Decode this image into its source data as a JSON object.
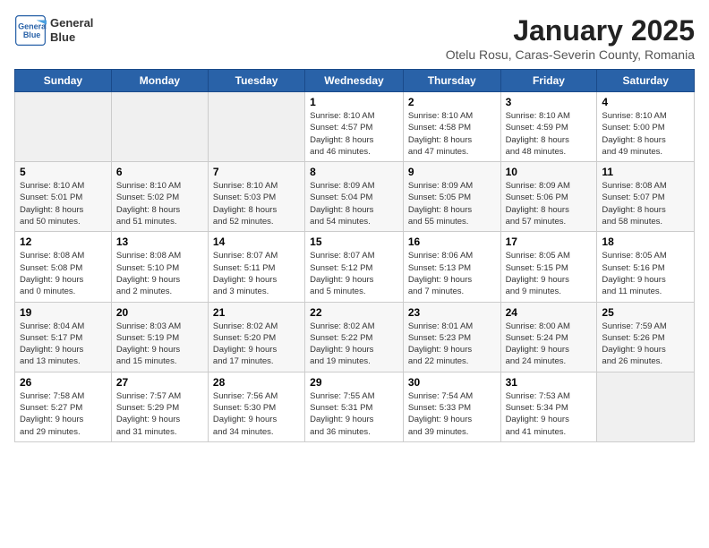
{
  "header": {
    "title": "January 2025",
    "subtitle": "Otelu Rosu, Caras-Severin County, Romania",
    "logo_line1": "General",
    "logo_line2": "Blue"
  },
  "days_of_week": [
    "Sunday",
    "Monday",
    "Tuesday",
    "Wednesday",
    "Thursday",
    "Friday",
    "Saturday"
  ],
  "weeks": [
    [
      {
        "day": "",
        "info": ""
      },
      {
        "day": "",
        "info": ""
      },
      {
        "day": "",
        "info": ""
      },
      {
        "day": "1",
        "info": "Sunrise: 8:10 AM\nSunset: 4:57 PM\nDaylight: 8 hours\nand 46 minutes."
      },
      {
        "day": "2",
        "info": "Sunrise: 8:10 AM\nSunset: 4:58 PM\nDaylight: 8 hours\nand 47 minutes."
      },
      {
        "day": "3",
        "info": "Sunrise: 8:10 AM\nSunset: 4:59 PM\nDaylight: 8 hours\nand 48 minutes."
      },
      {
        "day": "4",
        "info": "Sunrise: 8:10 AM\nSunset: 5:00 PM\nDaylight: 8 hours\nand 49 minutes."
      }
    ],
    [
      {
        "day": "5",
        "info": "Sunrise: 8:10 AM\nSunset: 5:01 PM\nDaylight: 8 hours\nand 50 minutes."
      },
      {
        "day": "6",
        "info": "Sunrise: 8:10 AM\nSunset: 5:02 PM\nDaylight: 8 hours\nand 51 minutes."
      },
      {
        "day": "7",
        "info": "Sunrise: 8:10 AM\nSunset: 5:03 PM\nDaylight: 8 hours\nand 52 minutes."
      },
      {
        "day": "8",
        "info": "Sunrise: 8:09 AM\nSunset: 5:04 PM\nDaylight: 8 hours\nand 54 minutes."
      },
      {
        "day": "9",
        "info": "Sunrise: 8:09 AM\nSunset: 5:05 PM\nDaylight: 8 hours\nand 55 minutes."
      },
      {
        "day": "10",
        "info": "Sunrise: 8:09 AM\nSunset: 5:06 PM\nDaylight: 8 hours\nand 57 minutes."
      },
      {
        "day": "11",
        "info": "Sunrise: 8:08 AM\nSunset: 5:07 PM\nDaylight: 8 hours\nand 58 minutes."
      }
    ],
    [
      {
        "day": "12",
        "info": "Sunrise: 8:08 AM\nSunset: 5:08 PM\nDaylight: 9 hours\nand 0 minutes."
      },
      {
        "day": "13",
        "info": "Sunrise: 8:08 AM\nSunset: 5:10 PM\nDaylight: 9 hours\nand 2 minutes."
      },
      {
        "day": "14",
        "info": "Sunrise: 8:07 AM\nSunset: 5:11 PM\nDaylight: 9 hours\nand 3 minutes."
      },
      {
        "day": "15",
        "info": "Sunrise: 8:07 AM\nSunset: 5:12 PM\nDaylight: 9 hours\nand 5 minutes."
      },
      {
        "day": "16",
        "info": "Sunrise: 8:06 AM\nSunset: 5:13 PM\nDaylight: 9 hours\nand 7 minutes."
      },
      {
        "day": "17",
        "info": "Sunrise: 8:05 AM\nSunset: 5:15 PM\nDaylight: 9 hours\nand 9 minutes."
      },
      {
        "day": "18",
        "info": "Sunrise: 8:05 AM\nSunset: 5:16 PM\nDaylight: 9 hours\nand 11 minutes."
      }
    ],
    [
      {
        "day": "19",
        "info": "Sunrise: 8:04 AM\nSunset: 5:17 PM\nDaylight: 9 hours\nand 13 minutes."
      },
      {
        "day": "20",
        "info": "Sunrise: 8:03 AM\nSunset: 5:19 PM\nDaylight: 9 hours\nand 15 minutes."
      },
      {
        "day": "21",
        "info": "Sunrise: 8:02 AM\nSunset: 5:20 PM\nDaylight: 9 hours\nand 17 minutes."
      },
      {
        "day": "22",
        "info": "Sunrise: 8:02 AM\nSunset: 5:22 PM\nDaylight: 9 hours\nand 19 minutes."
      },
      {
        "day": "23",
        "info": "Sunrise: 8:01 AM\nSunset: 5:23 PM\nDaylight: 9 hours\nand 22 minutes."
      },
      {
        "day": "24",
        "info": "Sunrise: 8:00 AM\nSunset: 5:24 PM\nDaylight: 9 hours\nand 24 minutes."
      },
      {
        "day": "25",
        "info": "Sunrise: 7:59 AM\nSunset: 5:26 PM\nDaylight: 9 hours\nand 26 minutes."
      }
    ],
    [
      {
        "day": "26",
        "info": "Sunrise: 7:58 AM\nSunset: 5:27 PM\nDaylight: 9 hours\nand 29 minutes."
      },
      {
        "day": "27",
        "info": "Sunrise: 7:57 AM\nSunset: 5:29 PM\nDaylight: 9 hours\nand 31 minutes."
      },
      {
        "day": "28",
        "info": "Sunrise: 7:56 AM\nSunset: 5:30 PM\nDaylight: 9 hours\nand 34 minutes."
      },
      {
        "day": "29",
        "info": "Sunrise: 7:55 AM\nSunset: 5:31 PM\nDaylight: 9 hours\nand 36 minutes."
      },
      {
        "day": "30",
        "info": "Sunrise: 7:54 AM\nSunset: 5:33 PM\nDaylight: 9 hours\nand 39 minutes."
      },
      {
        "day": "31",
        "info": "Sunrise: 7:53 AM\nSunset: 5:34 PM\nDaylight: 9 hours\nand 41 minutes."
      },
      {
        "day": "",
        "info": ""
      }
    ]
  ]
}
